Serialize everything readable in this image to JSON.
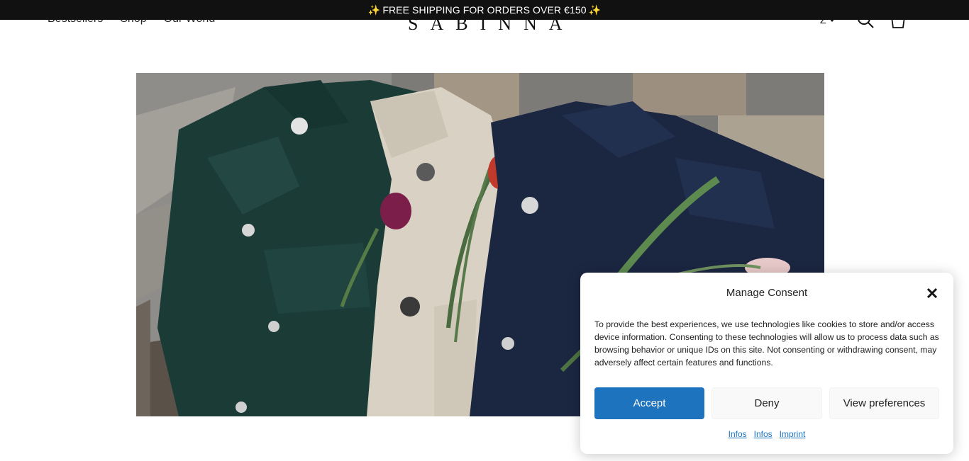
{
  "announcement": {
    "spark_icon": "sparkles-emoji",
    "text": "FREE SHIPPING FOR ORDERS OVER €150",
    "spark_left": "✨",
    "spark_right": "✨"
  },
  "header": {
    "nav": [
      "Bestsellers",
      "Shop",
      "Our World"
    ],
    "logo": "SABINNA",
    "language": "Z",
    "icons": [
      "chevron-down-icon",
      "search-icon",
      "bag-icon"
    ]
  },
  "hero": {
    "image": "three jackets (green, beige, navy) with tulips lying on a wooden bench"
  },
  "consent": {
    "title": "Manage Consent",
    "text": "To provide the best experiences, we use technologies like cookies to store and/or access device information. Consenting to these technologies will allow us to process data such as browsing behavior or unique IDs on this site. Not consenting or withdrawing consent, may adversely affect certain features and functions.",
    "accept_label": "Accept",
    "deny_label": "Deny",
    "preferences_label": "View preferences",
    "links": [
      "Infos",
      "Infos",
      "Imprint"
    ],
    "accent_color": "#1e73be"
  }
}
